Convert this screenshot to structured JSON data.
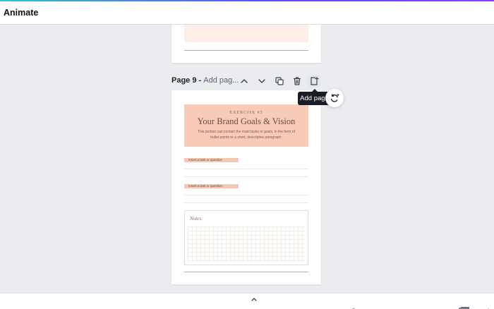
{
  "topbar": {
    "title": "Animate"
  },
  "page_header": {
    "page_label": "Page 9",
    "separator": " - ",
    "title_placeholder": "Add pag..."
  },
  "controls": {
    "move_up_icon": "chevron-up-icon",
    "move_down_icon": "chevron-down-icon",
    "duplicate_icon": "duplicate-icon",
    "delete_icon": "trash-icon",
    "add_icon": "add-page-icon"
  },
  "tooltip": {
    "text": "Add page"
  },
  "design": {
    "kicker": "EXERCISE #3",
    "title": "Your Brand Goals & Vision",
    "description": "This portion can contain the main tasks or goals, in the form of bullet points or a short, descriptive paragraph.",
    "tasks": [
      "Insert a task or question",
      "Insert a task or question"
    ],
    "notes_label": "Notes:"
  },
  "colors": {
    "accent_gradient_start": "#2ec5d3",
    "accent_gradient_end": "#8b3dff",
    "hero_bg": "#f7cbb8",
    "task_bg": "#f5c7b4",
    "rule": "#b9ad92",
    "tooltip_bg": "#1a1d23"
  }
}
